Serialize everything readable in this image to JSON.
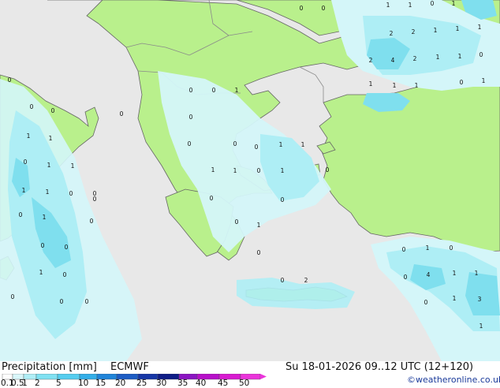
{
  "header": {
    "title": "Precipitation [mm]",
    "model": "ECMWF",
    "datetime": "Su 18-01-2026 09..12 UTC (12+120)",
    "credit": "©weatheronline.co.uk"
  },
  "legend": {
    "ticks": [
      "0.1",
      "0.5",
      "1",
      "2",
      "5",
      "10",
      "15",
      "20",
      "25",
      "30",
      "35",
      "40",
      "45",
      "50"
    ],
    "colors": [
      "#fefefe",
      "#d9f7fa",
      "#b0eef6",
      "#80e1f2",
      "#55cdef",
      "#33aee8",
      "#1f84d9",
      "#1c5cc4",
      "#1536a6",
      "#0e1c86",
      "#8b14c2",
      "#b70fc9",
      "#d81ad0",
      "#ea34da"
    ]
  },
  "colors": {
    "sea": "#e8e8e8",
    "land": "#b9f08c",
    "precip_light": "#d4f6f9",
    "precip_mid": "#aeeef5",
    "precip_heavy": "#7fdfee",
    "coastline": "#666666",
    "border": "#8a8a8a"
  },
  "map": {
    "labels": [
      {
        "v": "1"
      },
      {
        "v": "1"
      },
      {
        "v": "0"
      },
      {
        "v": "1"
      },
      {
        "v": "0"
      },
      {
        "v": "0"
      },
      {
        "v": "2"
      },
      {
        "v": "2"
      },
      {
        "v": "1"
      },
      {
        "v": "1"
      },
      {
        "v": "1"
      },
      {
        "v": "2"
      },
      {
        "v": "4"
      },
      {
        "v": "2"
      },
      {
        "v": "1"
      },
      {
        "v": "1"
      },
      {
        "v": "0"
      },
      {
        "v": "1"
      },
      {
        "v": "1"
      },
      {
        "v": "1"
      },
      {
        "v": "0"
      },
      {
        "v": "1"
      },
      {
        "v": "0"
      },
      {
        "v": "0"
      },
      {
        "v": "0"
      },
      {
        "v": "0"
      },
      {
        "v": "0"
      },
      {
        "v": "1"
      },
      {
        "v": "0"
      },
      {
        "v": "0"
      },
      {
        "v": "1"
      },
      {
        "v": "1"
      },
      {
        "v": "0"
      },
      {
        "v": "0"
      },
      {
        "v": "0"
      },
      {
        "v": "1"
      },
      {
        "v": "1"
      },
      {
        "v": "0"
      },
      {
        "v": "1"
      },
      {
        "v": "1"
      },
      {
        "v": "1"
      },
      {
        "v": "1"
      },
      {
        "v": "1"
      },
      {
        "v": "1"
      },
      {
        "v": "0"
      },
      {
        "v": "0"
      },
      {
        "v": "0"
      },
      {
        "v": "1"
      },
      {
        "v": "0"
      },
      {
        "v": "0"
      },
      {
        "v": "0"
      },
      {
        "v": "0"
      },
      {
        "v": "0"
      },
      {
        "v": "1"
      },
      {
        "v": "0"
      },
      {
        "v": "0"
      },
      {
        "v": "0"
      },
      {
        "v": "0"
      },
      {
        "v": "1"
      },
      {
        "v": "0"
      },
      {
        "v": "1"
      },
      {
        "v": "0"
      },
      {
        "v": "0"
      },
      {
        "v": "0"
      },
      {
        "v": "0"
      },
      {
        "v": "0"
      },
      {
        "v": "2"
      },
      {
        "v": "0"
      },
      {
        "v": "1"
      },
      {
        "v": "0"
      },
      {
        "v": "4"
      },
      {
        "v": "1"
      },
      {
        "v": "1"
      },
      {
        "v": "0"
      },
      {
        "v": "3"
      },
      {
        "v": "1"
      },
      {
        "v": "1"
      },
      {
        "v": "0"
      }
    ]
  }
}
